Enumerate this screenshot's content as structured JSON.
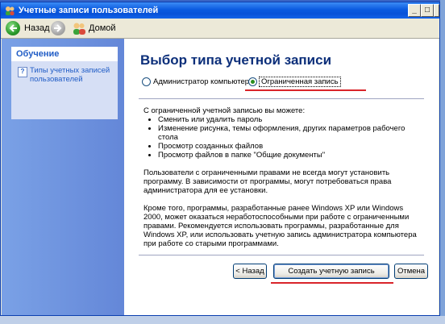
{
  "window": {
    "title": "Учетные записи пользователей",
    "controls": {
      "minimize": "_",
      "maximize": "□",
      "close": "X"
    }
  },
  "toolbar": {
    "back_label": "Назад",
    "home_label": "Домой"
  },
  "sidebar": {
    "panel_title": "Обучение",
    "link_label": "Типы учетных записей пользователей"
  },
  "main": {
    "heading": "Выбор типа учетной записи",
    "options": [
      {
        "label": "Администратор компьютера",
        "selected": false
      },
      {
        "label": "Ограниченная запись",
        "selected": true
      }
    ],
    "intro": "С ограниченной учетной записью вы можете:",
    "bullets": [
      "Сменить или удалить пароль",
      "Изменение рисунка, темы оформления, других параметров рабочего стола",
      "Просмотр созданных файлов",
      "Просмотр файлов в папке \"Общие документы\""
    ],
    "paragraph1": "Пользователи с ограниченными правами не всегда могут установить программу. В зависимости от программы, могут потребоваться права администратора для ее установки.",
    "paragraph2": "Кроме того, программы, разработанные ранее Windows XP или Windows 2000, может оказаться неработоспособными при работе с ограниченными правами. Рекомендуется использовать программы, разработанные для Windows XP, или использовать учетную запись администратора компьютера при работе со старыми программами."
  },
  "buttons": {
    "back": "< Назад",
    "create": "Создать учетную запись",
    "cancel": "Отмена"
  },
  "colors": {
    "title_bar": "#0a5ae0",
    "sidebar": "#6d94de",
    "heading": "#0c2f7a",
    "link": "#215dc6",
    "annotation_underline": "#d9242a"
  }
}
